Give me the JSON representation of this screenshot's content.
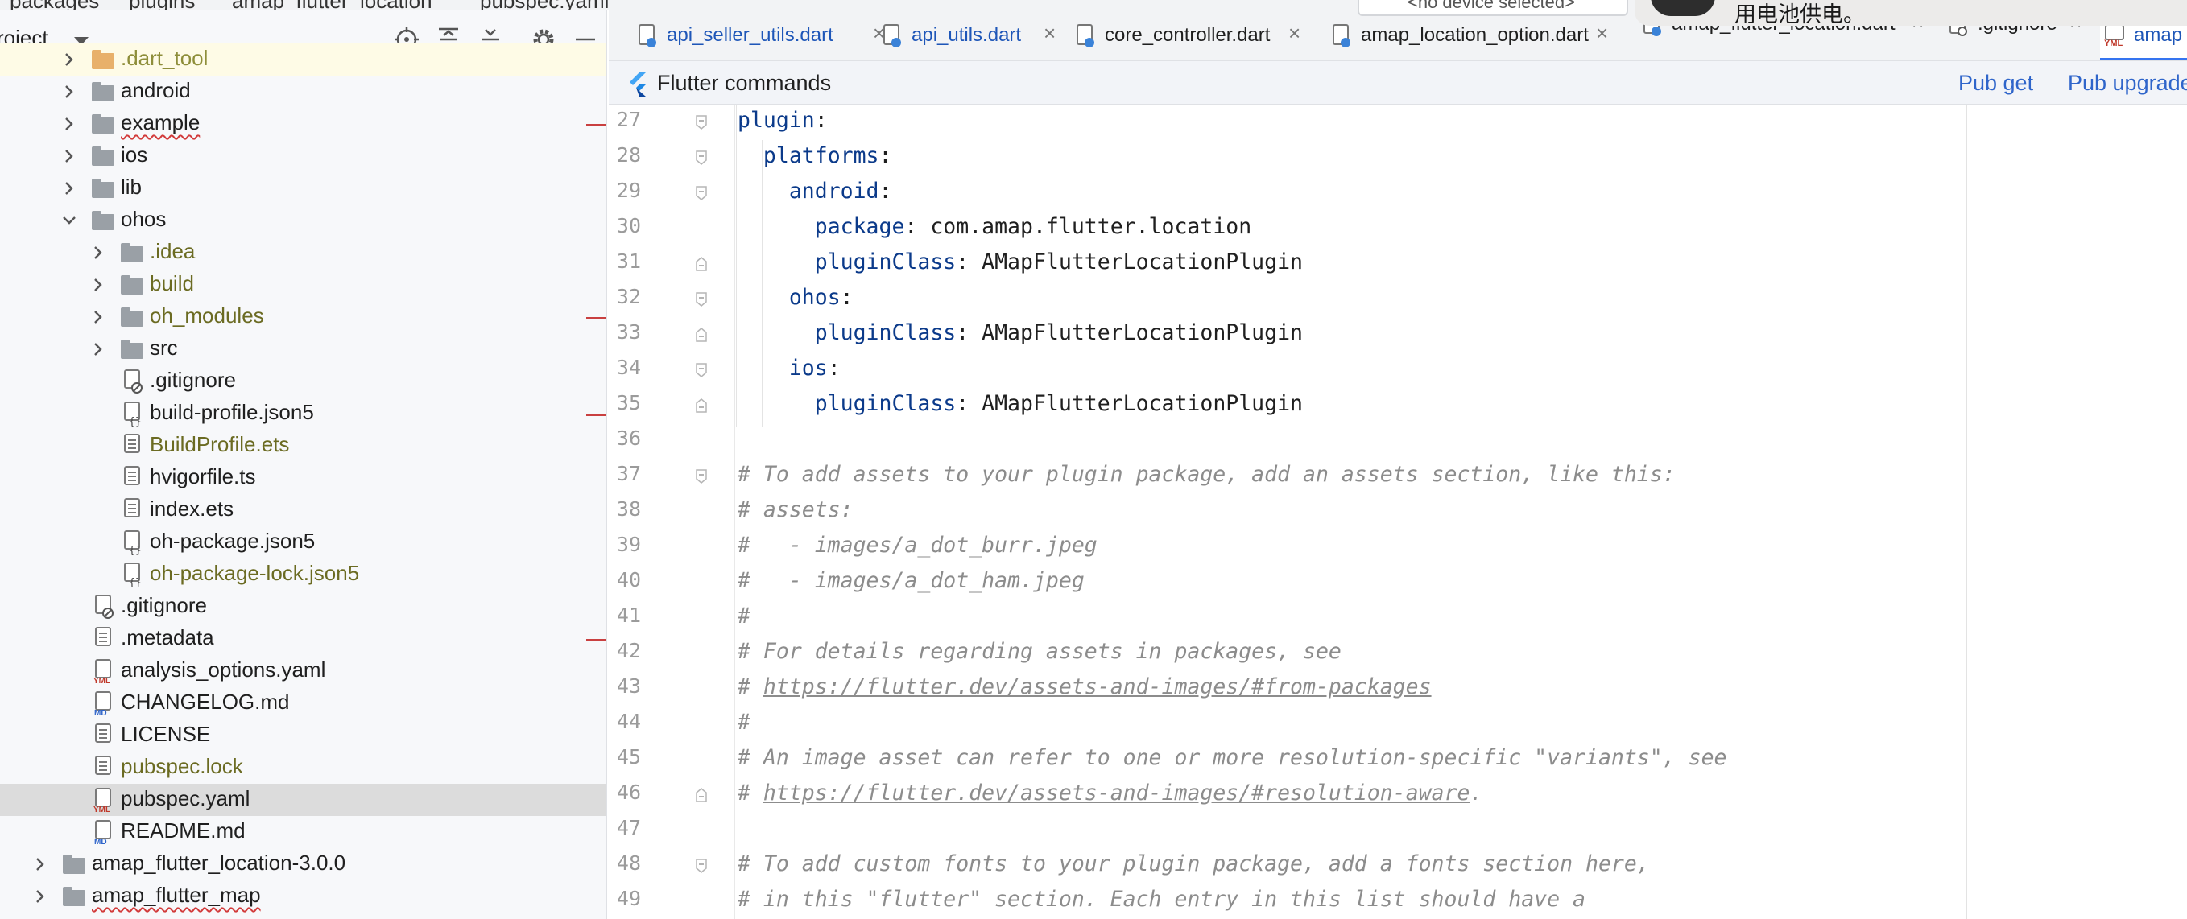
{
  "breadcrumbs": [
    "packages",
    "plugins",
    "amap_flutter_location",
    "pubspec.yaml"
  ],
  "project_panel": {
    "title": "roject",
    "tree": [
      {
        "name": ".dart_tool",
        "kind": "folder",
        "folder_color": "orange",
        "depth": 1,
        "chevron": "right",
        "style": "ignored",
        "highlight": true
      },
      {
        "name": "android",
        "kind": "folder",
        "depth": 1,
        "chevron": "right"
      },
      {
        "name": "example",
        "kind": "folder",
        "depth": 1,
        "chevron": "right",
        "squiggle": true,
        "marker": true
      },
      {
        "name": "ios",
        "kind": "folder",
        "depth": 1,
        "chevron": "right"
      },
      {
        "name": "lib",
        "kind": "folder",
        "depth": 1,
        "chevron": "right"
      },
      {
        "name": "ohos",
        "kind": "folder",
        "depth": 1,
        "chevron": "down"
      },
      {
        "name": ".idea",
        "kind": "folder",
        "depth": 2,
        "chevron": "right",
        "style": "olive"
      },
      {
        "name": "build",
        "kind": "folder",
        "depth": 2,
        "chevron": "right",
        "style": "olive"
      },
      {
        "name": "oh_modules",
        "kind": "folder",
        "depth": 2,
        "chevron": "right",
        "style": "olive",
        "marker": true
      },
      {
        "name": "src",
        "kind": "folder",
        "depth": 2,
        "chevron": "right"
      },
      {
        "name": ".gitignore",
        "kind": "gitignore",
        "depth": 2
      },
      {
        "name": "build-profile.json5",
        "kind": "json",
        "depth": 2,
        "marker": true
      },
      {
        "name": "BuildProfile.ets",
        "kind": "file",
        "depth": 2,
        "style": "olive"
      },
      {
        "name": "hvigorfile.ts",
        "kind": "file",
        "depth": 2
      },
      {
        "name": "index.ets",
        "kind": "file",
        "depth": 2
      },
      {
        "name": "oh-package.json5",
        "kind": "json",
        "depth": 2
      },
      {
        "name": "oh-package-lock.json5",
        "kind": "json",
        "depth": 2,
        "style": "olive"
      },
      {
        "name": ".gitignore",
        "kind": "gitignore",
        "depth": 1
      },
      {
        "name": ".metadata",
        "kind": "file",
        "depth": 1,
        "marker": true
      },
      {
        "name": "analysis_options.yaml",
        "kind": "yaml",
        "depth": 1
      },
      {
        "name": "CHANGELOG.md",
        "kind": "md",
        "depth": 1
      },
      {
        "name": "LICENSE",
        "kind": "file",
        "depth": 1
      },
      {
        "name": "pubspec.lock",
        "kind": "file",
        "depth": 1,
        "style": "olive"
      },
      {
        "name": "pubspec.yaml",
        "kind": "yaml",
        "depth": 1,
        "selected": true
      },
      {
        "name": "README.md",
        "kind": "md",
        "depth": 1
      },
      {
        "name": "amap_flutter_location-3.0.0",
        "kind": "folder",
        "depth": 0,
        "chevron": "right"
      },
      {
        "name": "amap_flutter_map",
        "kind": "folder",
        "depth": 0,
        "chevron": "right",
        "squiggle": true
      }
    ]
  },
  "editor_tabs": [
    {
      "label": "api_seller_utils.dart"
    },
    {
      "label": "api_utils.dart"
    },
    {
      "label": "core_controller.dart"
    },
    {
      "label": "amap_location_option.dart"
    },
    {
      "label": "amap_flutter_location.dart"
    },
    {
      "label": ".gitignore"
    },
    {
      "label": "amap",
      "active": true
    }
  ],
  "flutter_bar": {
    "title": "Flutter commands",
    "pub_get": "Pub get",
    "pub_upgrade": "Pub upgrade"
  },
  "device_selector": {
    "label": "<no device selected>"
  },
  "notification": {
    "text": "用电池供电。"
  },
  "colors": {
    "accent": "#3574f0",
    "keyword": "#0b3a8a",
    "comment": "#8c8c8c",
    "selection": "#dcdcdc",
    "vcs_marker": "#c94040"
  },
  "code_lines": [
    {
      "n": "27",
      "fold": "open",
      "parts": [
        {
          "t": "plugin",
          "s": "k"
        },
        {
          "t": ":",
          "s": "v"
        }
      ]
    },
    {
      "n": "28",
      "fold": "open",
      "parts": [
        {
          "t": "  ",
          "s": "v"
        },
        {
          "t": "platforms",
          "s": "k"
        },
        {
          "t": ":",
          "s": "v"
        }
      ]
    },
    {
      "n": "29",
      "fold": "open",
      "parts": [
        {
          "t": "    ",
          "s": "v"
        },
        {
          "t": "android",
          "s": "k"
        },
        {
          "t": ":",
          "s": "v"
        }
      ]
    },
    {
      "n": "30",
      "parts": [
        {
          "t": "      ",
          "s": "v"
        },
        {
          "t": "package",
          "s": "k"
        },
        {
          "t": ": com.amap.flutter.location",
          "s": "v"
        }
      ]
    },
    {
      "n": "31",
      "fold": "close",
      "parts": [
        {
          "t": "      ",
          "s": "v"
        },
        {
          "t": "pluginClass",
          "s": "k"
        },
        {
          "t": ": AMapFlutterLocationPlugin",
          "s": "v"
        }
      ]
    },
    {
      "n": "32",
      "fold": "open",
      "parts": [
        {
          "t": "    ",
          "s": "v"
        },
        {
          "t": "ohos",
          "s": "k"
        },
        {
          "t": ":",
          "s": "v"
        }
      ]
    },
    {
      "n": "33",
      "fold": "close",
      "parts": [
        {
          "t": "      ",
          "s": "v"
        },
        {
          "t": "pluginClass",
          "s": "k"
        },
        {
          "t": ": AMapFlutterLocationPlugin",
          "s": "v"
        }
      ]
    },
    {
      "n": "34",
      "fold": "open",
      "parts": [
        {
          "t": "    ",
          "s": "v"
        },
        {
          "t": "ios",
          "s": "k"
        },
        {
          "t": ":",
          "s": "v"
        }
      ]
    },
    {
      "n": "35",
      "fold": "close",
      "parts": [
        {
          "t": "      ",
          "s": "v"
        },
        {
          "t": "pluginClass",
          "s": "k"
        },
        {
          "t": ": AMapFlutterLocationPlugin",
          "s": "v"
        }
      ]
    },
    {
      "n": "36",
      "parts": []
    },
    {
      "n": "37",
      "fold": "open",
      "parts": [
        {
          "t": "# To add assets to your plugin package, add an assets section, like this:",
          "s": "c"
        }
      ]
    },
    {
      "n": "38",
      "parts": [
        {
          "t": "# assets:",
          "s": "c"
        }
      ]
    },
    {
      "n": "39",
      "parts": [
        {
          "t": "#   - images/a_dot_burr.jpeg",
          "s": "c"
        }
      ]
    },
    {
      "n": "40",
      "parts": [
        {
          "t": "#   - images/a_dot_ham.jpeg",
          "s": "c"
        }
      ]
    },
    {
      "n": "41",
      "parts": [
        {
          "t": "#",
          "s": "c"
        }
      ]
    },
    {
      "n": "42",
      "parts": [
        {
          "t": "# For details regarding assets in packages, see",
          "s": "c"
        }
      ]
    },
    {
      "n": "43",
      "parts": [
        {
          "t": "# ",
          "s": "c"
        },
        {
          "t": "https://flutter.dev/assets-and-images/#from-packages",
          "s": "u"
        }
      ]
    },
    {
      "n": "44",
      "parts": [
        {
          "t": "#",
          "s": "c"
        }
      ]
    },
    {
      "n": "45",
      "parts": [
        {
          "t": "# An image asset can refer to one or more resolution-specific \"variants\", see",
          "s": "c"
        }
      ]
    },
    {
      "n": "46",
      "fold": "close",
      "parts": [
        {
          "t": "# ",
          "s": "c"
        },
        {
          "t": "https://flutter.dev/assets-and-images/#resolution-aware",
          "s": "u"
        },
        {
          "t": ".",
          "s": "c"
        }
      ]
    },
    {
      "n": "47",
      "parts": []
    },
    {
      "n": "48",
      "fold": "open",
      "parts": [
        {
          "t": "# To add custom fonts to your plugin package, add a fonts section here,",
          "s": "c"
        }
      ]
    },
    {
      "n": "49",
      "parts": [
        {
          "t": "# in this \"flutter\" section. Each entry in this list should have a",
          "s": "c"
        }
      ]
    }
  ]
}
